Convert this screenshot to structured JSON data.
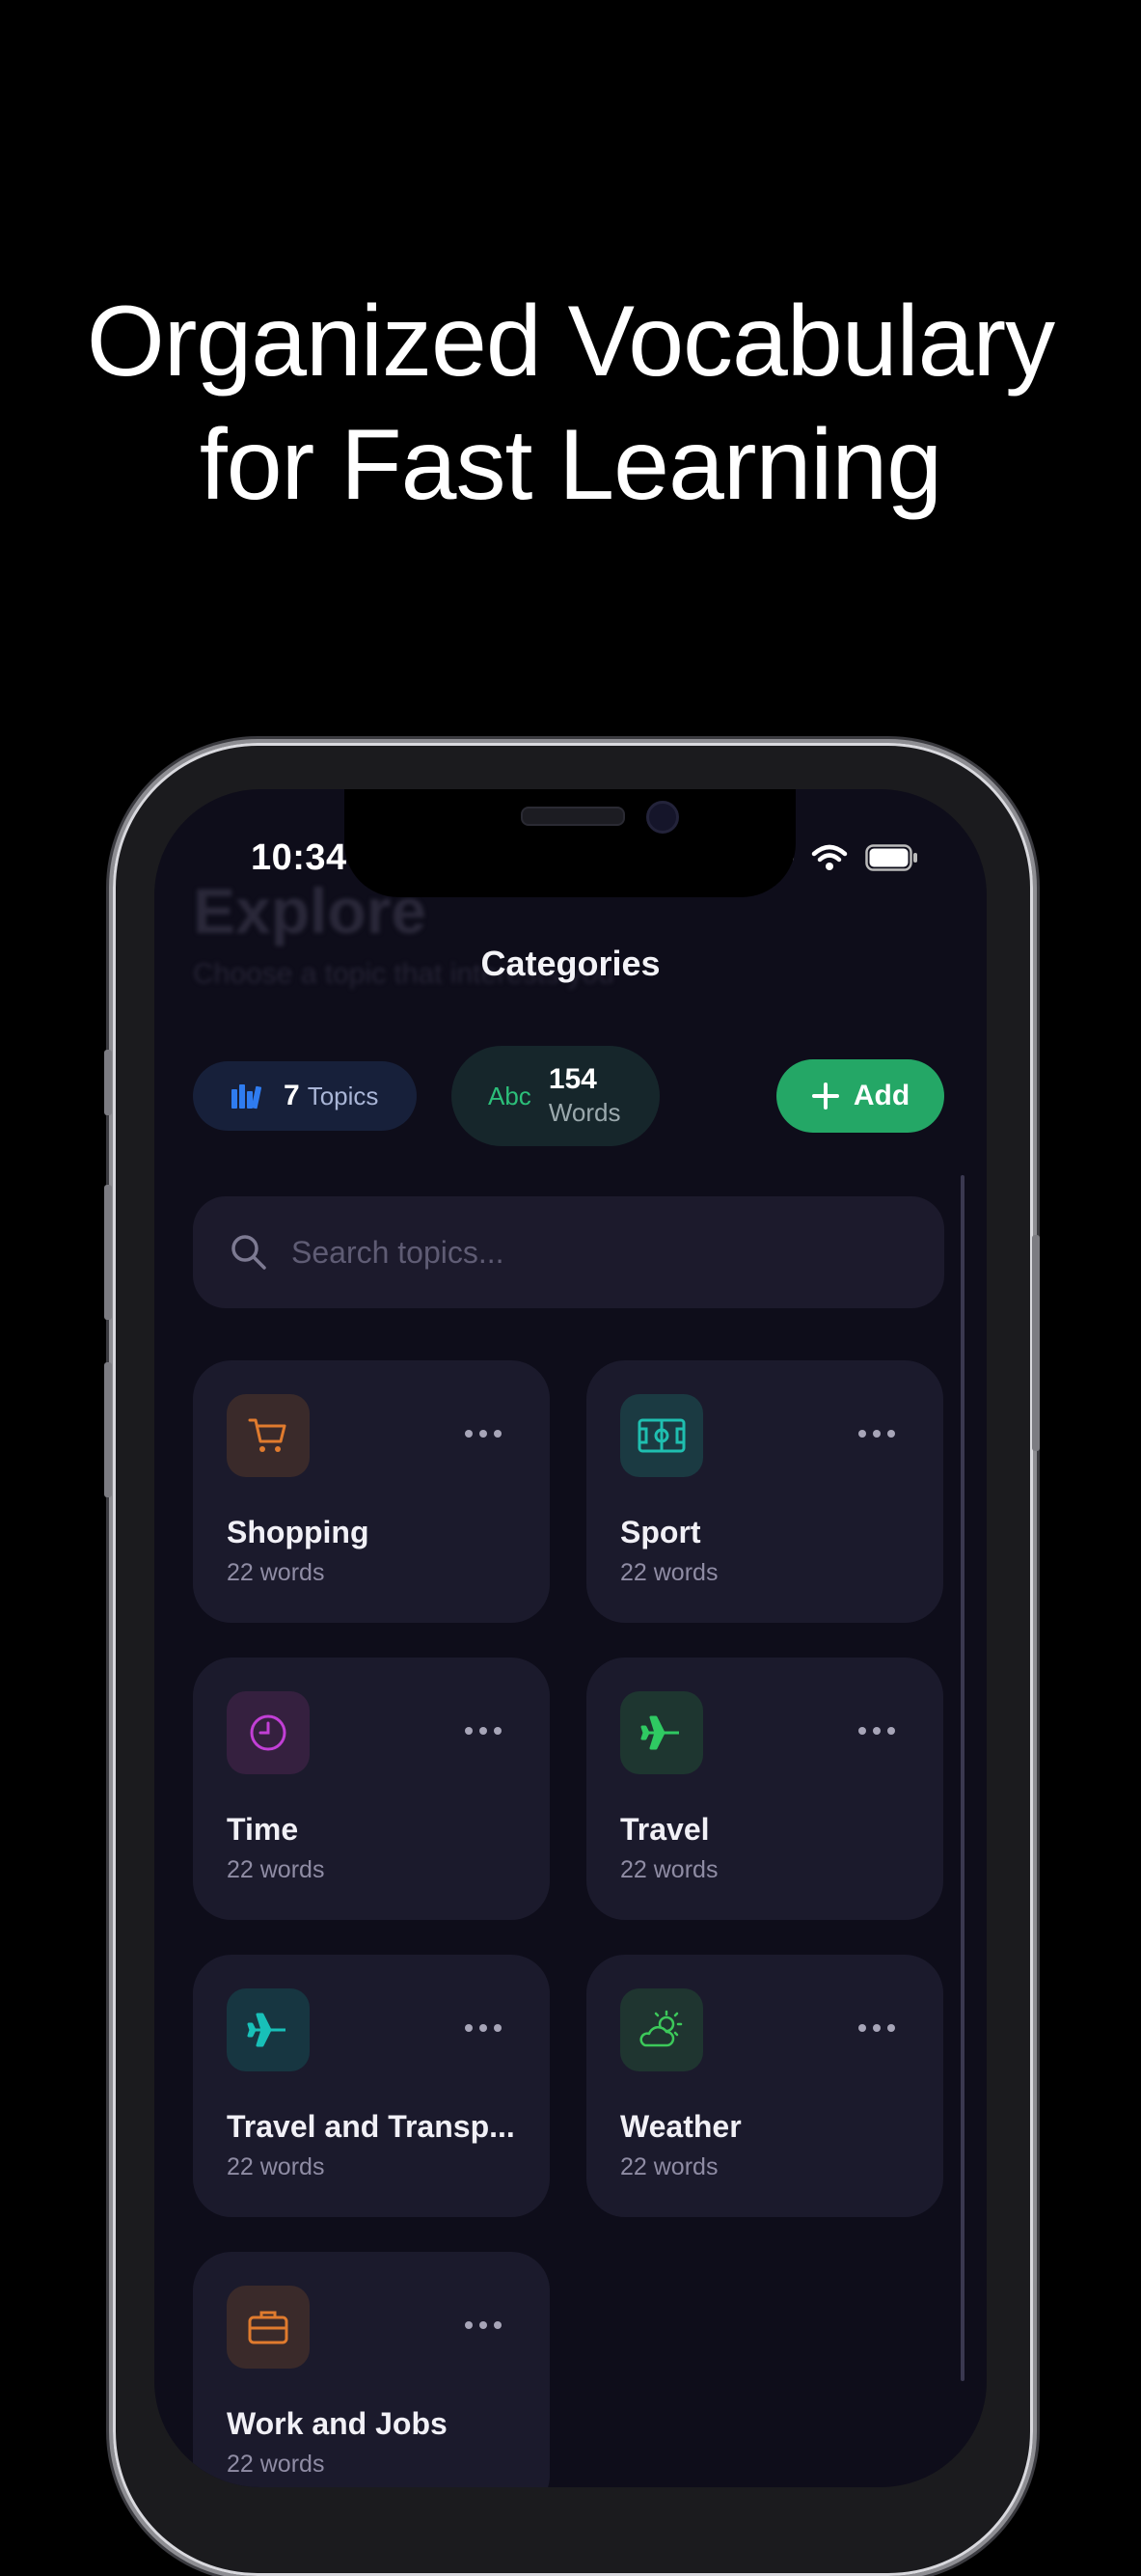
{
  "headline": {
    "line1": "Organized Vocabulary",
    "line2": "for Fast Learning"
  },
  "status_bar": {
    "time": "10:34"
  },
  "background": {
    "ghost_title": "Explore",
    "ghost_subtitle": "Choose a topic that interests you"
  },
  "nav": {
    "title": "Categories"
  },
  "stats": {
    "topics_count": "7",
    "topics_label": "Topics",
    "words_icon_text": "Abc",
    "words_count": "154",
    "words_label": "Words"
  },
  "add_button": {
    "label": "Add"
  },
  "search": {
    "placeholder": "Search topics..."
  },
  "categories": [
    {
      "title": "Shopping",
      "count": "22 words",
      "icon": "cart-icon",
      "color": "#e07b2e",
      "bg": "#3a2a2a"
    },
    {
      "title": "Sport",
      "count": "22 words",
      "icon": "field-icon",
      "color": "#1fbfb0",
      "bg": "#1b3a42"
    },
    {
      "title": "Time",
      "count": "22 words",
      "icon": "clock-icon",
      "color": "#c23fd6",
      "bg": "#35203f"
    },
    {
      "title": "Travel",
      "count": "22 words",
      "icon": "plane-icon",
      "color": "#2fca62",
      "bg": "#1e3630"
    },
    {
      "title": "Travel and Transp...",
      "count": "22 words",
      "icon": "plane-icon",
      "color": "#18c0b8",
      "bg": "#173641"
    },
    {
      "title": "Weather",
      "count": "22 words",
      "icon": "partly-cloudy-icon",
      "color": "#3cc95a",
      "bg": "#1f3530"
    },
    {
      "title": "Work and Jobs",
      "count": "22 words",
      "icon": "briefcase-icon",
      "color": "#e07b2e",
      "bg": "#3a2a2a"
    }
  ]
}
